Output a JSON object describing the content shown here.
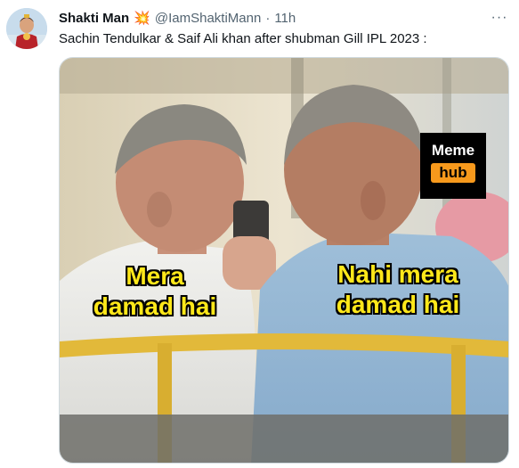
{
  "tweet": {
    "display_name": "Shakti Man",
    "emoji": "💥",
    "handle": "@IamShaktiMann",
    "separator": "·",
    "time": "11h",
    "more_icon": "more-horizontal-icon",
    "text": "Sachin Tendulkar & Saif Ali khan after shubman Gill IPL 2023 :"
  },
  "meme": {
    "logo_line1": "Meme",
    "logo_line2": "hub",
    "caption_left_line1": "Mera",
    "caption_left_line2": "damad hai",
    "caption_right_line1": "Nahi mera",
    "caption_right_line2": "damad hai"
  },
  "colors": {
    "caption": "#ffe81a",
    "logo_accent": "#f7991c",
    "muted_text": "#536471"
  }
}
